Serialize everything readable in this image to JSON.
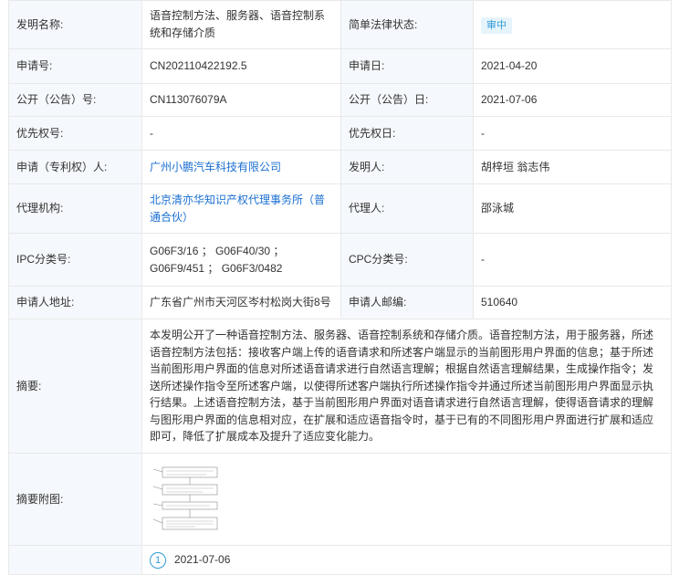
{
  "rows": {
    "invention_name_label": "发明名称:",
    "invention_name": "语音控制方法、服务器、语音控制系统和存储介质",
    "legal_status_label": "简单法律状态:",
    "legal_status": "审中",
    "app_no_label": "申请号:",
    "app_no": "CN202110422192.5",
    "app_date_label": "申请日:",
    "app_date": "2021-04-20",
    "pub_no_label": "公开（公告）号:",
    "pub_no": "CN113076079A",
    "pub_date_label": "公开（公告）日:",
    "pub_date": "2021-07-06",
    "priority_no_label": "优先权号:",
    "priority_no": "-",
    "priority_date_label": "优先权日:",
    "priority_date": "-",
    "applicant_label": "申请（专利权）人:",
    "applicant": "广州小鹏汽车科技有限公司",
    "inventor_label": "发明人:",
    "inventor": "胡梓垣 翁志伟",
    "agency_label": "代理机构:",
    "agency": "北京清亦华知识产权代理事务所（普通合伙）",
    "agent_label": "代理人:",
    "agent": "邵泳城",
    "ipc_label": "IPC分类号:",
    "ipc": "G06F3/16 ； G06F40/30 ； G06F9/451 ； G06F3/0482",
    "cpc_label": "CPC分类号:",
    "cpc": "-",
    "address_label": "申请人地址:",
    "address": "广东省广州市天河区岑村松岗大街8号",
    "postcode_label": "申请人邮编:",
    "postcode": "510640",
    "abstract_label": "摘要:",
    "abstract": "本发明公开了一种语音控制方法、服务器、语音控制系统和存储介质。语音控制方法，用于服务器，所述语音控制方法包括：接收客户端上传的语音请求和所述客户端显示的当前图形用户界面的信息；基于所述当前图形用户界面的信息对所述语音请求进行自然语言理解；根据自然语言理解结果，生成操作指令；发送所述操作指令至所述客户端，以使得所述客户端执行所述操作指令并通过所述当前图形用户界面显示执行结果。上述语音控制方法，基于当前图形用户界面对语音请求进行自然语言理解，使得语音请求的理解与图形用户界面的信息相对应，在扩展和适应语音指令时，基于已有的不同图形用户界面进行扩展和适应即可，降低了扩展成本及提升了适应变化能力。",
    "abstract_figure_label": "摘要附图:"
  },
  "timeline": [
    {
      "index": "1",
      "date": "2021-07-06"
    }
  ],
  "colors": {
    "label_bg": "#f5f8fc",
    "link": "#1a6fd1",
    "badge_bg": "#e6f4fb",
    "badge_text": "#2f9bd6",
    "border": "#e8e8e8"
  }
}
